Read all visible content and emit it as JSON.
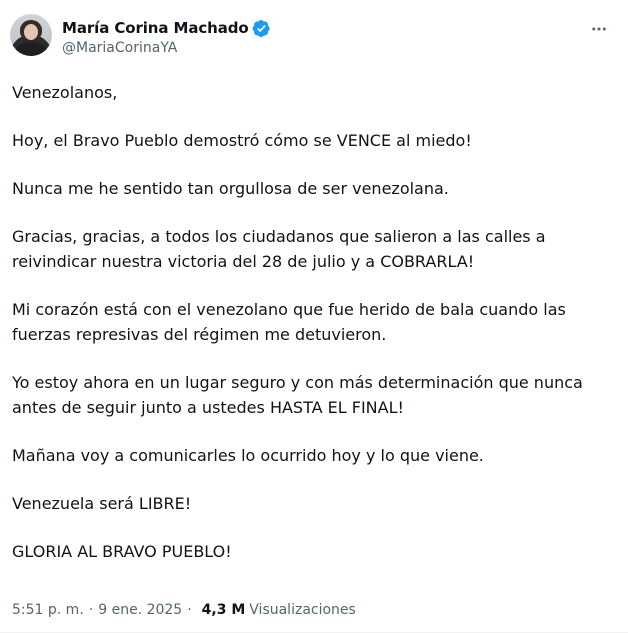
{
  "author": {
    "display_name": "María Corina Machado",
    "handle": "@MariaCorinaYA",
    "verified_icon": "verified-badge-icon",
    "avatar_icon": "avatar-image"
  },
  "more_icon": "more-horizontal-icon",
  "tweet": {
    "paragraphs": [
      "Venezolanos,",
      "Hoy, el Bravo Pueblo demostró cómo se VENCE al miedo!",
      "Nunca me he sentido tan orgullosa de ser venezolana.",
      "Gracias, gracias, a todos los ciudadanos que salieron a las calles a reivindicar nuestra victoria del 28 de julio y a COBRARLA!",
      "Mi corazón está con el venezolano que fue herido de bala cuando las fuerzas represivas del régimen me detuvieron.",
      "Yo estoy ahora en un lugar seguro y con más determinación que nunca antes de seguir junto a ustedes HASTA EL FINAL!",
      "Mañana voy a comunicarles lo ocurrido hoy y lo que viene.",
      "Venezuela será LIBRE!",
      "GLORIA AL BRAVO PUEBLO!"
    ]
  },
  "meta": {
    "time": "5:51 p. m.",
    "separator_1": "·",
    "date": "9 ene. 2025",
    "separator_2": "·",
    "views_count": "4,3 M",
    "views_label": "Visualizaciones"
  },
  "colors": {
    "text_primary": "#0f1419",
    "text_secondary": "#536471",
    "verified_blue": "#1d9bf0"
  }
}
